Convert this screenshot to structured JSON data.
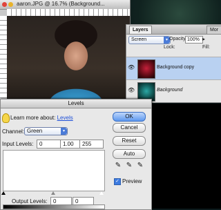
{
  "document": {
    "title": "aaron.JPG @ 16.7% (Background..."
  },
  "layers_panel": {
    "tabs": [
      "Layers",
      "Mor"
    ],
    "blend_mode": "Screen",
    "opacity_label": "Opacity:",
    "opacity_value": "100%",
    "lock_label": "Lock:",
    "fill_label": "Fill:",
    "fill_value": "100%",
    "layers": [
      {
        "name": "Background copy",
        "selected": true
      },
      {
        "name": "Background",
        "selected": false
      }
    ]
  },
  "levels_dialog": {
    "title": "Levels",
    "learn_text": "Learn more about:",
    "learn_link": "Levels",
    "channel_label": "Channel:",
    "channel_value": "Green",
    "input_levels_label": "Input Levels:",
    "input_black": "0",
    "input_gamma": "1.00",
    "input_white": "255",
    "output_levels_label": "Output Levels:",
    "output_black": "0",
    "output_white": "0",
    "buttons": {
      "ok": "OK",
      "cancel": "Cancel",
      "reset": "Reset",
      "auto": "Auto"
    },
    "preview_label": "Preview",
    "preview_checked": true
  },
  "colors": {
    "accent": "#4a7bd8",
    "link": "#1b4dd8",
    "selection": "#b9d1f1"
  }
}
